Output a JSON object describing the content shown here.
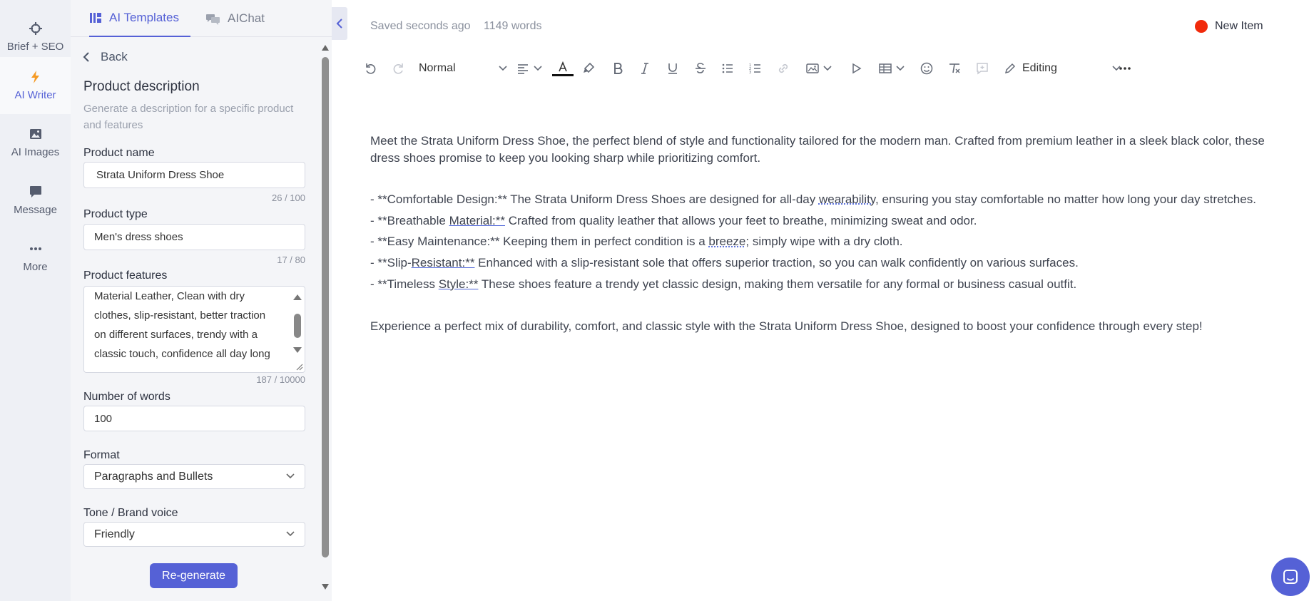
{
  "rail": {
    "items": [
      {
        "label": "Brief + SEO",
        "icon": "crosshair-icon"
      },
      {
        "label": "AI Writer",
        "icon": "lightning-icon"
      },
      {
        "label": "AI Images",
        "icon": "image-icon"
      },
      {
        "label": "Message",
        "icon": "message-icon"
      },
      {
        "label": "More",
        "icon": "more-dots-icon"
      }
    ]
  },
  "panel": {
    "tabs": [
      {
        "label": "AI Templates"
      },
      {
        "label": "AIChat"
      }
    ],
    "back_label": "Back",
    "title": "Product description",
    "subtitle": "Generate a description for a specific product and features",
    "product_name": {
      "label": "Product name",
      "value": "Strata Uniform Dress Shoe",
      "counter": "26 / 100"
    },
    "product_type": {
      "label": "Product type",
      "value": "Men's dress shoes",
      "counter": "17 / 80"
    },
    "product_features": {
      "label": "Product features",
      "value": "Material Leather, Clean with dry clothes, slip-resistant, better traction on different surfaces, trendy with a classic touch, confidence all day long",
      "counter": "187 / 10000"
    },
    "number_of_words": {
      "label": "Number of words",
      "value": "100"
    },
    "format": {
      "label": "Format",
      "value": "Paragraphs and Bullets"
    },
    "tone": {
      "label": "Tone / Brand voice",
      "value": "Friendly"
    },
    "regenerate_label": "Re-generate"
  },
  "editor": {
    "status_saved": "Saved seconds ago",
    "status_words": "1149 words",
    "new_item_label": "New Item",
    "new_item_color": "#f12a0b",
    "toolbar": {
      "block_type": "Normal",
      "mode": "Editing"
    },
    "content": {
      "intro": "Meet the Strata Uniform Dress Shoe, the perfect blend of style and functionality tailored for the modern man. Crafted from premium leather in a sleek black color, these dress shoes promise to keep you looking sharp while prioritizing comfort.",
      "bullets": [
        {
          "before": "- **Comfortable Design:** The Strata Uniform Dress Shoes are designed for all-day ",
          "marked": "wearability",
          "after": ", ensuring you stay comfortable no matter how long your day stretches."
        },
        {
          "before": "- **Breathable ",
          "marked": "Material:**",
          "after": " Crafted from quality leather that allows your feet to breathe, minimizing sweat and odor."
        },
        {
          "before": "- **Easy Maintenance:** Keeping them in perfect condition is a ",
          "marked": "breeze;",
          "after": " simply wipe with a dry cloth."
        },
        {
          "before": "- **Slip-",
          "marked": "Resistant:**",
          "after": " Enhanced with a slip-resistant sole that offers superior traction, so you can walk confidently on various surfaces."
        },
        {
          "before": "- **Timeless ",
          "marked": "Style:**",
          "after": " These shoes feature a trendy yet classic design, making them versatile for any formal or business casual outfit."
        }
      ],
      "outro": "Experience a perfect mix of durability, comfort, and classic style with the Strata Uniform Dress Shoe, designed to boost your confidence through every step!"
    }
  },
  "colors": {
    "accent": "#5561d6",
    "rail_bg": "#eef0f5",
    "panel_bg": "#f4f5f8"
  }
}
